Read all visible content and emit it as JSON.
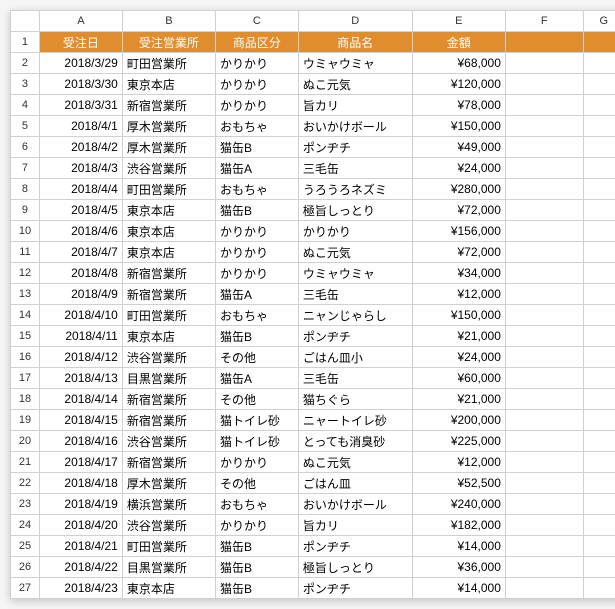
{
  "columns": [
    "A",
    "B",
    "C",
    "D",
    "E",
    "F",
    "G"
  ],
  "header_row": {
    "row_num": 1,
    "cells": [
      "受注日",
      "受注営業所",
      "商品区分",
      "商品名",
      "金額",
      "",
      ""
    ]
  },
  "rows": [
    {
      "n": 2,
      "date": "2018/3/29",
      "office": "町田営業所",
      "cat": "かりかり",
      "prod": "ウミャウミャ",
      "amt": "¥68,000"
    },
    {
      "n": 3,
      "date": "2018/3/30",
      "office": "東京本店",
      "cat": "かりかり",
      "prod": "ぬこ元気",
      "amt": "¥120,000"
    },
    {
      "n": 4,
      "date": "2018/3/31",
      "office": "新宿営業所",
      "cat": "かりかり",
      "prod": "旨カリ",
      "amt": "¥78,000"
    },
    {
      "n": 5,
      "date": "2018/4/1",
      "office": "厚木営業所",
      "cat": "おもちゃ",
      "prod": "おいかけボール",
      "amt": "¥150,000"
    },
    {
      "n": 6,
      "date": "2018/4/2",
      "office": "厚木営業所",
      "cat": "猫缶B",
      "prod": "ポンヂチ",
      "amt": "¥49,000"
    },
    {
      "n": 7,
      "date": "2018/4/3",
      "office": "渋谷営業所",
      "cat": "猫缶A",
      "prod": "三毛缶",
      "amt": "¥24,000"
    },
    {
      "n": 8,
      "date": "2018/4/4",
      "office": "町田営業所",
      "cat": "おもちゃ",
      "prod": "うろうろネズミ",
      "amt": "¥280,000"
    },
    {
      "n": 9,
      "date": "2018/4/5",
      "office": "東京本店",
      "cat": "猫缶B",
      "prod": "極旨しっとり",
      "amt": "¥72,000"
    },
    {
      "n": 10,
      "date": "2018/4/6",
      "office": "東京本店",
      "cat": "かりかり",
      "prod": "かりかり",
      "amt": "¥156,000"
    },
    {
      "n": 11,
      "date": "2018/4/7",
      "office": "東京本店",
      "cat": "かりかり",
      "prod": "ぬこ元気",
      "amt": "¥72,000"
    },
    {
      "n": 12,
      "date": "2018/4/8",
      "office": "新宿営業所",
      "cat": "かりかり",
      "prod": "ウミャウミャ",
      "amt": "¥34,000"
    },
    {
      "n": 13,
      "date": "2018/4/9",
      "office": "新宿営業所",
      "cat": "猫缶A",
      "prod": "三毛缶",
      "amt": "¥12,000"
    },
    {
      "n": 14,
      "date": "2018/4/10",
      "office": "町田営業所",
      "cat": "おもちゃ",
      "prod": "ニャンじゃらし",
      "amt": "¥150,000"
    },
    {
      "n": 15,
      "date": "2018/4/11",
      "office": "東京本店",
      "cat": "猫缶B",
      "prod": "ポンヂチ",
      "amt": "¥21,000"
    },
    {
      "n": 16,
      "date": "2018/4/12",
      "office": "渋谷営業所",
      "cat": "その他",
      "prod": "ごはん皿小",
      "amt": "¥24,000"
    },
    {
      "n": 17,
      "date": "2018/4/13",
      "office": "目黒営業所",
      "cat": "猫缶A",
      "prod": "三毛缶",
      "amt": "¥60,000"
    },
    {
      "n": 18,
      "date": "2018/4/14",
      "office": "新宿営業所",
      "cat": "その他",
      "prod": "猫ちぐら",
      "amt": "¥21,000"
    },
    {
      "n": 19,
      "date": "2018/4/15",
      "office": "新宿営業所",
      "cat": "猫トイレ砂",
      "prod": "ニャートイレ砂",
      "amt": "¥200,000"
    },
    {
      "n": 20,
      "date": "2018/4/16",
      "office": "渋谷営業所",
      "cat": "猫トイレ砂",
      "prod": "とっても消臭砂",
      "amt": "¥225,000"
    },
    {
      "n": 21,
      "date": "2018/4/17",
      "office": "新宿営業所",
      "cat": "かりかり",
      "prod": "ぬこ元気",
      "amt": "¥12,000"
    },
    {
      "n": 22,
      "date": "2018/4/18",
      "office": "厚木営業所",
      "cat": "その他",
      "prod": "ごはん皿",
      "amt": "¥52,500"
    },
    {
      "n": 23,
      "date": "2018/4/19",
      "office": "横浜営業所",
      "cat": "おもちゃ",
      "prod": "おいかけボール",
      "amt": "¥240,000"
    },
    {
      "n": 24,
      "date": "2018/4/20",
      "office": "渋谷営業所",
      "cat": "かりかり",
      "prod": "旨カリ",
      "amt": "¥182,000"
    },
    {
      "n": 25,
      "date": "2018/4/21",
      "office": "町田営業所",
      "cat": "猫缶B",
      "prod": "ポンヂチ",
      "amt": "¥14,000"
    },
    {
      "n": 26,
      "date": "2018/4/22",
      "office": "目黒営業所",
      "cat": "猫缶B",
      "prod": "極旨しっとり",
      "amt": "¥36,000"
    },
    {
      "n": 27,
      "date": "2018/4/23",
      "office": "東京本店",
      "cat": "猫缶B",
      "prod": "ポンヂチ",
      "amt": "¥14,000"
    }
  ]
}
